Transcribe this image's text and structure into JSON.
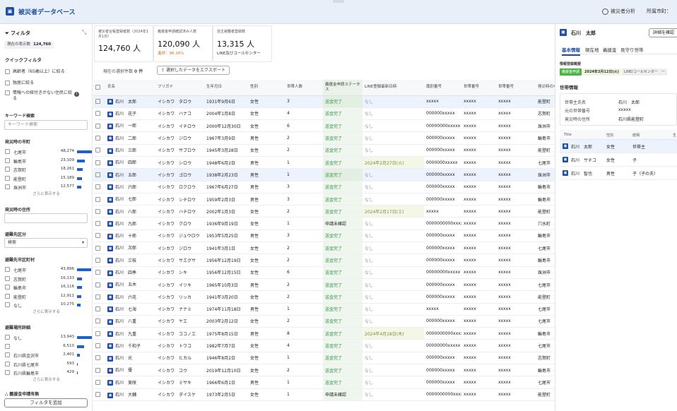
{
  "header": {
    "logo_icon": "building-icon",
    "title": "被災者データベース",
    "analytics_label": "被災者分析",
    "city_label": "所属市町："
  },
  "sidebar": {
    "title": "フィルタ",
    "count_label": "現在の表示数",
    "count_value": "124,760",
    "quick_title": "クイックフィルタ",
    "quick": [
      "高齢者（65歳以上）に絞る",
      "独居に絞る",
      "情報への紐付きがない住民に絞る"
    ],
    "keyword_title": "キーワード検索",
    "keyword_placeholder": "キーワード検索",
    "city_title": "発災時の市町",
    "cities": [
      {
        "name": "七尾市",
        "count": "48,274",
        "value": 48274
      },
      {
        "name": "輪島市",
        "count": "23,109",
        "value": 23109
      },
      {
        "name": "志賀町",
        "count": "18,261",
        "value": 18261
      },
      {
        "name": "能登町",
        "count": "15,189",
        "value": 15189
      },
      {
        "name": "珠洲市",
        "count": "12,577",
        "value": 12577
      }
    ],
    "more_label": "さらに表示する",
    "address_title": "発災時の住所",
    "evac_title": "避難先区分",
    "evac_select": "検索",
    "evac_city_title": "避難先市区町村",
    "evac_cities": [
      {
        "name": "七尾市",
        "count": "43,896",
        "value": 43896
      },
      {
        "name": "志賀町",
        "count": "16,133",
        "value": 16133
      },
      {
        "name": "輪島市",
        "count": "16,116",
        "value": 16116
      },
      {
        "name": "能登町",
        "count": "12,911",
        "value": 12911
      },
      {
        "name": "なし",
        "count": "10,275",
        "value": 10275
      }
    ],
    "evac_detail_title": "避難場所詳細",
    "evac_details": [
      {
        "name": "なし",
        "count": "13,943",
        "value": 13943
      },
      {
        "name": "",
        "count": "6,510",
        "value": 6510
      },
      {
        "name": "石川県金沢市",
        "count": "2,401",
        "value": 2401
      },
      {
        "name": "石川県七尾市",
        "count": "593",
        "value": 593
      },
      {
        "name": "石川県輪島市",
        "count": "429",
        "value": 429
      }
    ],
    "support_title": "義援金申請有無",
    "add_filter": "フィルタを追加"
  },
  "stats": [
    {
      "label": "被災者台帳登録者数（2024年1月1日）",
      "value": "124,760 人",
      "sub": ""
    },
    {
      "label": "義援金申請確認済み人数",
      "value": "120,090 人",
      "sub": "進捗：96.26%"
    },
    {
      "label": "自主避難者登録数",
      "value": "13,315 人",
      "sub": "LINE及びコールセンター"
    }
  ],
  "toolbar": {
    "selected_label": "現在の選択件数",
    "selected_count": "0 件",
    "export_label": "選択したデータをエクスポート"
  },
  "table": {
    "columns": [
      "氏名",
      "フリガナ",
      "生年月日",
      "性別",
      "世帯人数",
      "義援金申請ステータス",
      "LINE登録最新日時",
      "識別番号",
      "世帯番号",
      "世帯番号",
      "発災時の市町",
      "発災時の住"
    ],
    "rows": [
      [
        "石川　太郎",
        "イシカワ　タロウ",
        "1931年9月6日",
        "女性",
        "3",
        "送金完了",
        "なし",
        "xxxxx",
        "xxxxx",
        "xxxxx",
        "能登町",
        "石川県能登"
      ],
      [
        "石川　花子",
        "イシカワ　ハナコ",
        "2004年1月8日",
        "女性",
        "4",
        "送金完了",
        "なし",
        "000000xxxxx",
        "xxxxx",
        "xxxxx",
        "志賀町",
        "石川県羽咋"
      ],
      [
        "石川　一郎",
        "イシカワ　イチロウ",
        "2000年12月30日",
        "女性",
        "6",
        "送金完了",
        "なし",
        "00000000xxxxx",
        "xxxxx",
        "xxxxx",
        "珠洲市",
        "石川県珠洲"
      ],
      [
        "石川　二郎",
        "イシカワ　ジロウ",
        "1967年3月9日",
        "男性",
        "2",
        "送金完了",
        "なし",
        "000000xxxxx",
        "xxxxx",
        "xxxxx",
        "輪島市",
        "石川県輪島"
      ],
      [
        "石川　三郎",
        "イシカワ　サブロウ",
        "1945年3月28日",
        "女性",
        "2",
        "送金完了",
        "なし",
        "000000xxxxx",
        "xxxxx",
        "xxxxx",
        "能登町",
        "石川県鳳珠"
      ],
      [
        "石川　四郎",
        "イシカワ　シロウ",
        "1948年6月2日",
        "男性",
        "1",
        "送金完了",
        "2024年2月27日(火)",
        "0000000xxxxx",
        "xxxxx",
        "xxxxx",
        "七尾市",
        "石川県七尾"
      ],
      [
        "石川　五郎",
        "イシカワ　ゴロウ",
        "1938年2月23日",
        "男性",
        "1",
        "送金完了",
        "なし",
        "000000xxxxx",
        "xxxxx",
        "xxxxx",
        "珠洲市",
        "石川県珠洲"
      ],
      [
        "石川　六郎",
        "イシカワ　ロクロウ",
        "1967年6月27日",
        "男性",
        "3",
        "送金完了",
        "なし",
        "000000xxxxx",
        "xxxxx",
        "xxxxx",
        "輪島市",
        "石川県輪島"
      ],
      [
        "石川　七郎",
        "イシカワ　シチロウ",
        "1959年2月3日",
        "男性",
        "3",
        "送金完了",
        "なし",
        "000000xxxxx",
        "xxxxx",
        "xxxxx",
        "輪島市",
        "石川県輪島"
      ],
      [
        "石川　八郎",
        "イシカワ　ハチロウ",
        "2002年1月3日",
        "女性",
        "2",
        "送金完了",
        "2024年2月17日(土)",
        "xxxxx",
        "xxxxx",
        "xxxxx",
        "能登町",
        "石川県能登"
      ],
      [
        "石川　九郎",
        "イシカワ　クロウ",
        "1936年9月19日",
        "女性",
        "1",
        "申請未確認",
        "なし",
        "0000000000xxxxx",
        "xxxxx",
        "xxxxx",
        "穴水町",
        "石川県鳳珠"
      ],
      [
        "石川　十郎",
        "イシカワ　ジュウロウ",
        "1953年5月25日",
        "男性",
        "3",
        "送金完了",
        "なし",
        "000000xxxxx",
        "xxxxx",
        "xxxxx",
        "輪島市",
        "石川県輪島"
      ],
      [
        "石川　次郎",
        "イシカワ　ジロウ",
        "1941年3月1日",
        "女性",
        "2",
        "送金完了",
        "なし",
        "000000xxxxx",
        "xxxxx",
        "xxxxx",
        "七尾市",
        "石川県七尾"
      ],
      [
        "石川　三枝",
        "イシカワ　サエグサ",
        "1956年12月19日",
        "女性",
        "2",
        "送金完了",
        "なし",
        "000000xxxxx",
        "xxxxx",
        "xxxxx",
        "輪島市",
        "石川県輪島"
      ],
      [
        "石川　四季",
        "イシカワ　シキ",
        "1956年12月15日",
        "女性",
        "6",
        "送金完了",
        "なし",
        "00000000xxxxx",
        "xxxxx",
        "xxxxx",
        "珠洲市",
        "石川県珠洲"
      ],
      [
        "石川　五木",
        "イシカワ　イツキ",
        "1965年10月3日",
        "男性",
        "2",
        "送金完了",
        "なし",
        "000000xxxxx",
        "xxxxx",
        "xxxxx",
        "七尾市",
        "石川県七尾"
      ],
      [
        "石川　六花",
        "イシカワ　リッカ",
        "1941年3月20日",
        "女性",
        "2",
        "送金完了",
        "なし",
        "000000xxxxx",
        "xxxxx",
        "xxxxx",
        "能登町",
        "石川県鳳珠"
      ],
      [
        "石川　七海",
        "イシカワ　ナナミ",
        "1974年11月18日",
        "男性",
        "1",
        "送金完了",
        "なし",
        "xxxxx",
        "xxxxx",
        "xxxxx",
        "七尾市",
        "石川県七尾"
      ],
      [
        "石川　八重",
        "イシカワ　ヤエ",
        "2003年2月12日",
        "女性",
        "2",
        "送金完了",
        "なし",
        "000000xxxxx",
        "xxxxx",
        "xxxxx",
        "七尾市",
        "石川県七尾"
      ],
      [
        "石川　九重",
        "イシカワ　ココノエ",
        "1975年8月15日",
        "男性",
        "8",
        "送金完了",
        "2024年4月18日(木)",
        "0000000000xxxxx",
        "xxxxx",
        "xxxxx",
        "輪島市",
        "石川県輪島"
      ],
      [
        "石川　千和子",
        "イシカワ　トワコ",
        "1982年7月7日",
        "女性",
        "4",
        "送金完了",
        "なし",
        "00000000xxxxx",
        "xxxxx",
        "xxxxx",
        "七尾市",
        "石川県七尾"
      ],
      [
        "石川　光",
        "イシカワ　ヒカル",
        "1946年8月2日",
        "女性",
        "1",
        "送金完了",
        "なし",
        "000000xxxxx",
        "xxxxx",
        "xxxxx",
        "志賀町",
        "石川県羽咋"
      ],
      [
        "石川　優",
        "イシカワ　ユウ",
        "2019年12月10日",
        "女性",
        "2",
        "送金完了",
        "なし",
        "000000xxxxx",
        "xxxxx",
        "xxxxx",
        "輪島市",
        "石川県輪島"
      ],
      [
        "石川　美咲",
        "イシカワ　ミサキ",
        "1966年6月1日",
        "男性",
        "1",
        "送金完了",
        "なし",
        "000000xxxxx",
        "xxxxx",
        "xxxxx",
        "七尾市",
        "石川県七尾"
      ],
      [
        "石川　大輔",
        "イシカワ　ダイスケ",
        "1973年2月5日",
        "女性",
        "1",
        "申請未確認",
        "なし",
        "0000000000xxxxx",
        "xxxxx",
        "xxxxx",
        "能登町",
        "石川県鳳珠"
      ]
    ]
  },
  "detail": {
    "name": "石川　太郎",
    "detail_button": "詳細を確認",
    "tabs": [
      "基本情報",
      "現在地",
      "義援金",
      "見守り世帯"
    ],
    "reg_title": "情報登録概要",
    "reg_status": "義援金申請",
    "reg_date": "2024年3月12日(火)",
    "reg_line": "LINE/コールセンター　ー",
    "household_title": "世帯情報",
    "kv": [
      {
        "k": "世帯主氏名",
        "v": "石川　太郎"
      },
      {
        "k": "元の世帯番号",
        "v": "xxxxx"
      },
      {
        "k": "発災時の住所",
        "v": "石川県能登町"
      }
    ],
    "member_cols": [
      "Title",
      "性別",
      "続柄",
      "生"
    ],
    "members": [
      {
        "name": "石川　太郎",
        "sex": "女性",
        "rel": "世帯主"
      },
      {
        "name": "石川　サチコ",
        "sex": "女性",
        "rel": "子"
      },
      {
        "name": "石川　智也",
        "sex": "男性",
        "rel": "子（子の夫）"
      }
    ]
  }
}
